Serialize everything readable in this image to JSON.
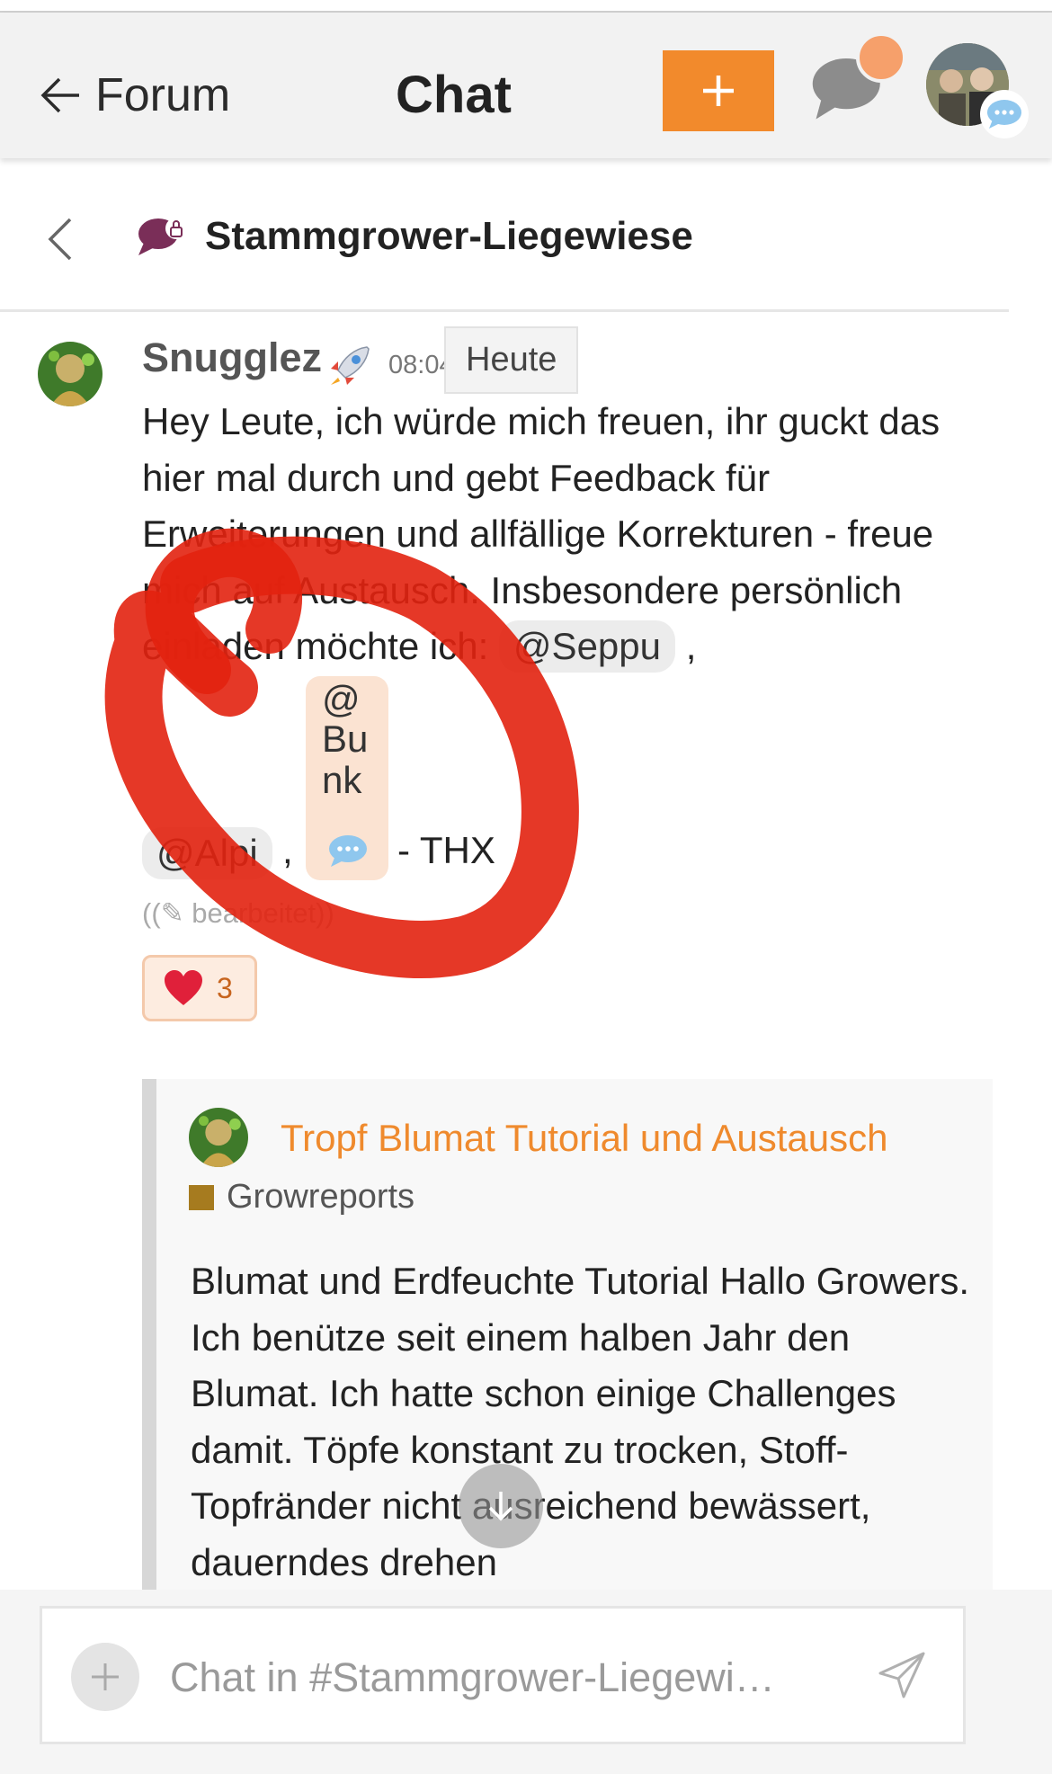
{
  "header": {
    "back_label": "Forum",
    "title": "Chat",
    "accent_color": "#f28a2c"
  },
  "channel": {
    "name": "Stammgrower-Liegewiese"
  },
  "message": {
    "username": "Snugglez",
    "time": "08:04",
    "tooltip": "Heute",
    "text_intro": "Hey Leute, ich würde mich freuen, ihr guckt das hier mal durch und gebt Feedback für Erweiterungen und allfällige Korrekturen - freue mich auf Austausch. Insbesondere persönlich einladen möchte ich:",
    "mention_1": "@Seppu",
    "comma_1": ",",
    "mention_2_lines": [
      "@",
      "Bu",
      "nk"
    ],
    "mention_3": "@Alpi",
    "comma_2": ",",
    "suffix": "- THX",
    "edited": "((✎ bearbeitet))",
    "reaction_count": "3"
  },
  "onebox": {
    "title": "Tropf Blumat Tutorial und Austausch",
    "category": "Growreports",
    "category_color": "#a67b1f",
    "excerpt": "Blumat und Erdfeuchte Tutorial Hallo Growers. Ich benütze seit einem halben Jahr den Blumat. Ich hatte schon einige Challenges damit. Töpfe konstant zu trocken, Stoff-Topfränder nicht ausreichend bewässert, dauerndes drehen"
  },
  "composer": {
    "placeholder": "Chat in #Stammgrower-Liegewi…"
  }
}
